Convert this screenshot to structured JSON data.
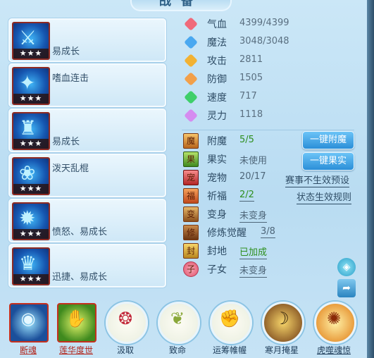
{
  "title": "战备",
  "skills": [
    {
      "name": "易成长",
      "stars": "★★★",
      "icon": "spear-icon"
    },
    {
      "name": "嗜血连击",
      "stars": "★★★",
      "icon": "bloodthirst-icon"
    },
    {
      "name": "易成长",
      "stars": "★★★",
      "icon": "armor-icon"
    },
    {
      "name": "泼天乱棍",
      "stars": "★★★",
      "icon": "dragon-icon"
    },
    {
      "name": "愤怒、易成长",
      "stars": "★★★",
      "icon": "rage-icon"
    },
    {
      "name": "迅捷、易成长",
      "stars": "★★★",
      "icon": "swift-icon"
    }
  ],
  "stats": [
    {
      "label": "气血",
      "value": "4399/4399",
      "color": "#f06a7a",
      "icon": "heart-icon"
    },
    {
      "label": "魔法",
      "value": "3048/3048",
      "color": "#4aa8f0",
      "icon": "mana-icon"
    },
    {
      "label": "攻击",
      "value": "2811",
      "color": "#f2b233",
      "icon": "attack-icon"
    },
    {
      "label": "防御",
      "value": "1505",
      "color": "#f2a04a",
      "icon": "defense-icon"
    },
    {
      "label": "速度",
      "value": "717",
      "color": "#3fcf6a",
      "icon": "speed-icon"
    },
    {
      "label": "灵力",
      "value": "1118",
      "color": "#d58cf0",
      "icon": "spirit-icon"
    }
  ],
  "attrs": {
    "fumo": {
      "label": "附魔",
      "value": "5/5"
    },
    "guoshi": {
      "label": "果实",
      "value": "未使用"
    },
    "chongwu": {
      "label": "宠物",
      "value": "20/17"
    },
    "qifu": {
      "label": "祈福",
      "value": "2/2"
    },
    "bianshen": {
      "label": "变身",
      "value": "未变身"
    },
    "xiulian": {
      "label": "修炼觉醒",
      "value": "3/8"
    },
    "fengdi": {
      "label": "封地",
      "value": "已加成"
    },
    "zinv": {
      "label": "子女",
      "value": "未变身"
    }
  },
  "buttons": {
    "one_click_fumo": "一键附魔",
    "one_click_fruit": "一键果实"
  },
  "links": {
    "event_preset": "赛事不生效预设",
    "state_rules": "状态生效规则"
  },
  "bottom": [
    {
      "label": "断魂",
      "glyph": "◉",
      "style": "square",
      "color": "#1b4f9a"
    },
    {
      "label": "莲华度世",
      "glyph": "✋",
      "style": "square",
      "color": "#3f8a1e"
    },
    {
      "label": "汲取",
      "glyph": "❂",
      "style": "round",
      "color": "#c2283a"
    },
    {
      "label": "致命",
      "glyph": "❦",
      "style": "round",
      "color": "#8aa83a"
    },
    {
      "label": "运筹帷幄",
      "glyph": "✊",
      "style": "round",
      "color": "#9a5a2a"
    },
    {
      "label": "寒月掩星",
      "glyph": "☽",
      "style": "round",
      "color": "#b8861e"
    },
    {
      "label": "虎噬魂惊",
      "glyph": "✺",
      "style": "round",
      "color": "#e07a12"
    }
  ]
}
